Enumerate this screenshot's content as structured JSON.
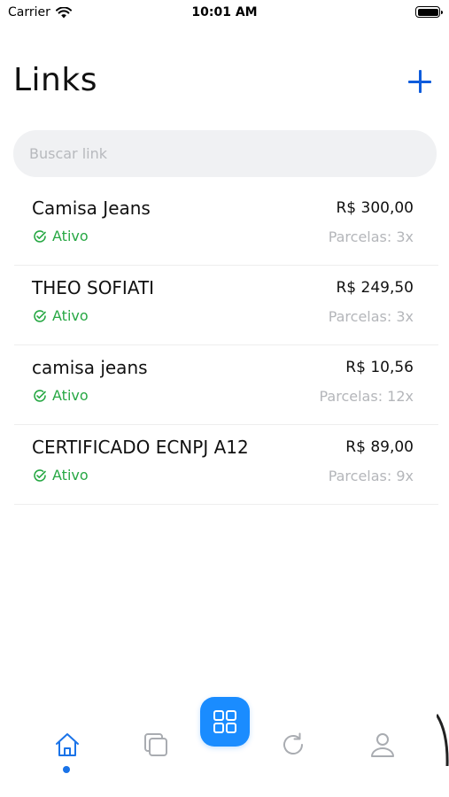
{
  "status_bar": {
    "carrier": "Carrier",
    "time": "10:01 AM"
  },
  "header": {
    "title": "Links",
    "add_icon": "plus-icon",
    "accent_color": "#0e5cdc"
  },
  "search": {
    "placeholder": "Buscar link",
    "value": ""
  },
  "links": [
    {
      "title": "Camisa Jeans",
      "price": "R$ 300,00",
      "status": "Ativo",
      "installments": "Parcelas: 3x"
    },
    {
      "title": "THEO SOFIATI",
      "price": "R$ 249,50",
      "status": "Ativo",
      "installments": "Parcelas: 3x"
    },
    {
      "title": "camisa jeans",
      "price": "R$ 10,56",
      "status": "Ativo",
      "installments": "Parcelas: 12x"
    },
    {
      "title": "CERTIFICADO ECNPJ A12",
      "price": "R$ 89,00",
      "status": "Ativo",
      "installments": "Parcelas: 9x"
    }
  ],
  "status_color": "#27a844",
  "bottom_nav": {
    "items": [
      {
        "icon": "home-icon",
        "active": true
      },
      {
        "icon": "copy-icon",
        "active": false
      },
      {
        "icon": "grid-icon",
        "active": false
      },
      {
        "icon": "refresh-icon",
        "active": false
      },
      {
        "icon": "user-icon",
        "active": false
      }
    ],
    "active_color": "#1a73e8",
    "center_button_color": "#1a8cff"
  }
}
